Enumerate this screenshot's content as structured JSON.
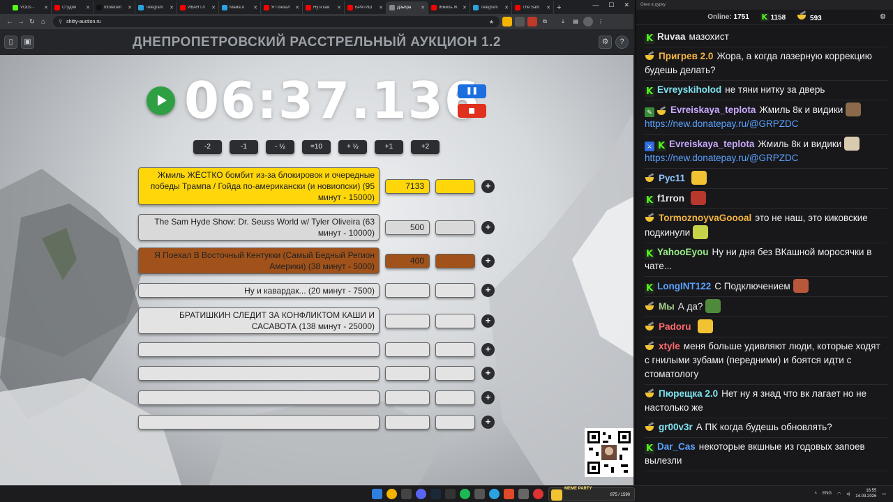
{
  "browser": {
    "tabs": [
      {
        "label": "VODs -",
        "color": "#53fc18",
        "active": false
      },
      {
        "label": "Студия",
        "color": "#ff0000",
        "active": false
      },
      {
        "label": "Intolerant",
        "color": "#111111",
        "active": false
      },
      {
        "label": "Telegram",
        "color": "#2aa3e0",
        "active": false
      },
      {
        "label": "ИВАН ГЛ",
        "color": "#ff0000",
        "active": false
      },
      {
        "label": "Мама я",
        "color": "#2aa3e0",
        "active": false
      },
      {
        "label": "Я Поехал",
        "color": "#ff0000",
        "active": false
      },
      {
        "label": "Ну и кав",
        "color": "#ff0000",
        "active": false
      },
      {
        "label": "БРАТИШ",
        "color": "#ff0000",
        "active": false
      },
      {
        "label": "Дзьбра",
        "color": "#888888",
        "active": true
      },
      {
        "label": "Жмиль Ж",
        "color": "#ff0000",
        "active": false
      },
      {
        "label": "Telegram",
        "color": "#2aa3e0",
        "active": false
      },
      {
        "label": "The Sam",
        "color": "#ff0000",
        "active": false
      }
    ],
    "url": "shitty-auction.ru"
  },
  "page": {
    "title": "ДНЕПРОПЕТРОВСКИЙ РАССТРЕЛЬНЫЙ АУКЦИОН 1.2",
    "timer": "06:37.136",
    "adjust_buttons": [
      "-2",
      "-1",
      "- ½",
      "=10",
      "+ ½",
      "+1",
      "+2"
    ],
    "lots": [
      {
        "name": "Жмиль ЖЁСТКО бомбит из-за блокировок и очередные победы Трампа / Гойда по-американски (и новиопски) (95 минут - 15000)",
        "amount": "7133",
        "color": "yellow"
      },
      {
        "name": "The Sam Hyde Show: Dr. Seuss World w/ Tyler Oliveira (63 минут - 10000)",
        "amount": "500",
        "color": "gray"
      },
      {
        "name": "Я Поехал В Восточный Кентукки (Самый Бедный Регион Америки) (38 минут - 5000)",
        "amount": "400",
        "color": "brown"
      },
      {
        "name": "Ну и кавардак... (20 минут - 7500)",
        "amount": "",
        "color": "light"
      },
      {
        "name": "БРАТИШКИН СЛЕДИТ ЗА КОНФЛИКТОМ КАШИ И САСАВОТА (138 минут - 25000)",
        "amount": "",
        "color": "light"
      },
      {
        "name": "",
        "amount": "",
        "color": "light"
      },
      {
        "name": "",
        "amount": "",
        "color": "light"
      },
      {
        "name": "",
        "amount": "",
        "color": "light"
      },
      {
        "name": "",
        "amount": "",
        "color": "light"
      }
    ]
  },
  "chat": {
    "window_title": "Окно в дурку",
    "online_label": "Online:",
    "online_count": "1751",
    "kick_count": "1158",
    "other_count": "593",
    "messages": [
      {
        "badges": [
          "kick"
        ],
        "user": "Ruvaa",
        "color": "#e8e8e8",
        "text": "мазохист"
      },
      {
        "badges": [
          "bowl"
        ],
        "user": "Пригрев 2.0",
        "color": "#f5b642",
        "text": "Жора, а когда лазерную коррекцию будешь делать?"
      },
      {
        "badges": [
          "kick"
        ],
        "user": "Evreyskiholod",
        "color": "#7fe4f0",
        "text": "не тяни нитку за дверь"
      },
      {
        "badges": [
          "pen",
          "bowl"
        ],
        "user": "Evreiskaya_teplota",
        "color": "#c9a9ff",
        "text": "Жмиль 8к и видики",
        "link": "https://new.donatepay.ru/@GRPZDC",
        "emote": "#8a6a4a"
      },
      {
        "badges": [
          "sword",
          "kick"
        ],
        "user": "Evreiskaya_teplota",
        "color": "#c9a9ff",
        "text": "Жмиль 8к и видики",
        "link": "https://new.donatepay.ru/@GRPZDC",
        "emote": "#d9cbb0"
      },
      {
        "badges": [
          "bowl"
        ],
        "user": "Рус11",
        "color": "#8ec7ff",
        "text": "",
        "emote": "#f1c232"
      },
      {
        "badges": [
          "kick"
        ],
        "user": "f1rron",
        "color": "#e8e8e8",
        "text": "",
        "emote": "#b8382e"
      },
      {
        "badges": [
          "bowl"
        ],
        "user": "TormoznoyvaGoooal",
        "color": "#f5b642",
        "text": "это не наш, это киковские подкинули",
        "emote": "#c6d24a"
      },
      {
        "badges": [
          "kick"
        ],
        "user": "YahooEyou",
        "color": "#9df08a",
        "text": "Ну ни дня без ВКашной моросячки в чате..."
      },
      {
        "badges": [
          "kick"
        ],
        "user": "LongINT122",
        "color": "#5aa2ff",
        "text": "С Подключением",
        "emote": "#b8573a"
      },
      {
        "badges": [
          "bowl"
        ],
        "user": "Мы",
        "color": "#a8d48c",
        "text": "А да?",
        "emote": "#4f8a3c"
      },
      {
        "badges": [
          "bowl"
        ],
        "user": "Padoru",
        "color": "#ff6b6b",
        "text": "",
        "emote": "#f1c232"
      },
      {
        "badges": [
          "bowl"
        ],
        "user": "xtyle",
        "color": "#ff6b6b",
        "text": "меня больше удивляют люди, которые ходят с гнилыми зубами (передними) и боятся идти с стоматологу"
      },
      {
        "badges": [
          "bowl"
        ],
        "user": "Пюрещка 2.0",
        "color": "#7fe4f0",
        "text": "Нет ну я знад что вк лагает но не настолько же"
      },
      {
        "badges": [
          "bowl"
        ],
        "user": "gr00v3r",
        "color": "#7fe4f0",
        "text": "А ПК когда будешь обновлять?"
      },
      {
        "badges": [
          "kick"
        ],
        "user": "Dar_Cas",
        "color": "#5aa2ff",
        "text": "некоторые вкшные из годовых запоев вылезли"
      }
    ]
  },
  "taskbar": {
    "meme_label": "MEME PARTY",
    "meme_count": "875 / 1590",
    "lang": "ENG",
    "time": "16:55",
    "date": "14.03.2026"
  }
}
